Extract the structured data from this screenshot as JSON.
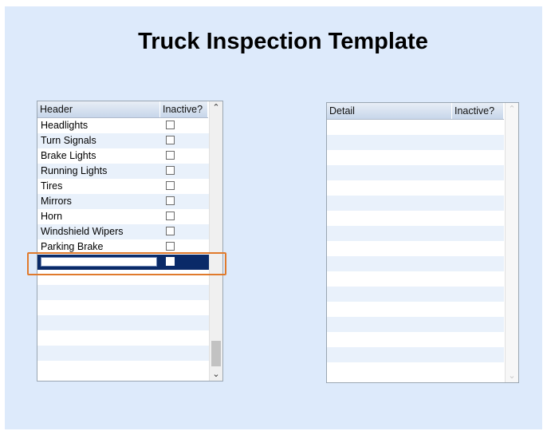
{
  "title": "Truck Inspection Template",
  "header_grid": {
    "columns": [
      "Header",
      "Inactive?"
    ],
    "rows": [
      {
        "label": "Headlights",
        "inactive": false
      },
      {
        "label": "Turn Signals",
        "inactive": false
      },
      {
        "label": "Brake Lights",
        "inactive": false
      },
      {
        "label": "Running Lights",
        "inactive": false
      },
      {
        "label": "Tires",
        "inactive": false
      },
      {
        "label": "Mirrors",
        "inactive": false
      },
      {
        "label": "Horn",
        "inactive": false
      },
      {
        "label": "Windshield Wipers",
        "inactive": false
      },
      {
        "label": "Parking Brake",
        "inactive": false
      }
    ],
    "new_row": {
      "value": "",
      "inactive": false
    },
    "scroll_up_icon": "chevron-up-icon",
    "scroll_down_icon": "chevron-down-icon"
  },
  "detail_grid": {
    "columns": [
      "Detail",
      "Inactive?"
    ],
    "rows": []
  },
  "colors": {
    "panel_bg": "#ddeafb",
    "selected_row": "#0a2a68",
    "highlight_border": "#e07a2c"
  }
}
